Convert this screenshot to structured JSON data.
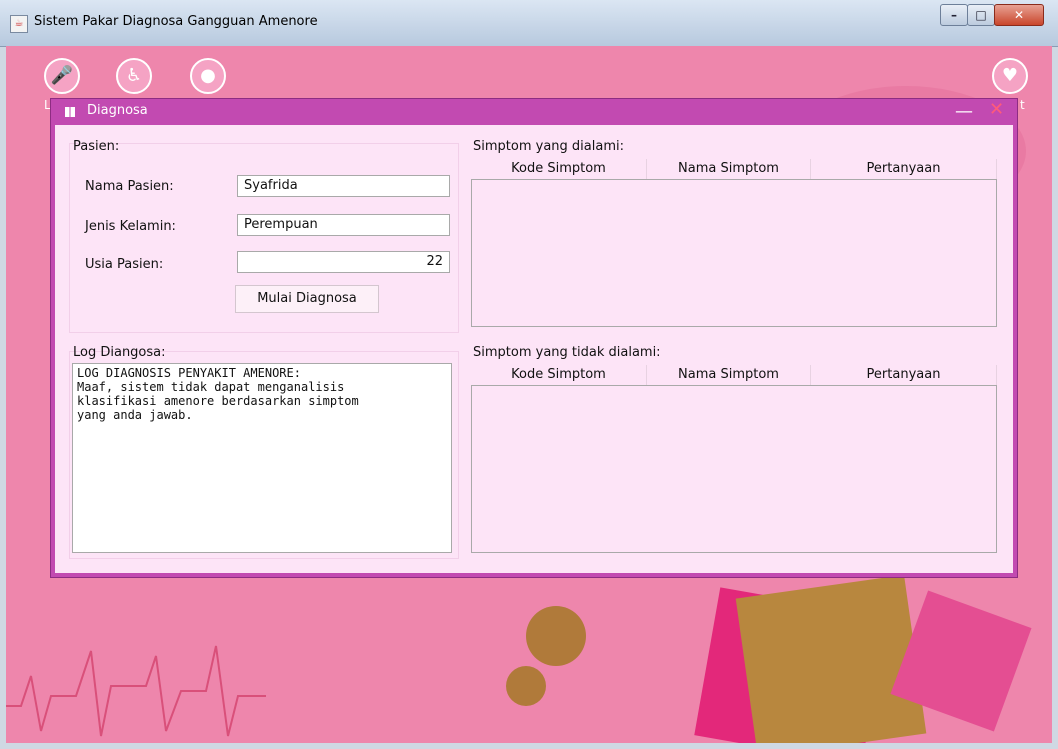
{
  "window": {
    "title": "Sistem Pakar Diagnosa Gangguan Amenore"
  },
  "toolbar": {
    "left_icons": [
      "microphone-icon",
      "wheelchair-icon",
      "user-icon"
    ],
    "right_icon": "heartbeat-icon",
    "peek_letter_left": "L",
    "peek_letter_right": "t"
  },
  "dialog": {
    "title": "Diagnosa",
    "minimize": "—",
    "close": "✕"
  },
  "patient": {
    "group_label": "Pasien:",
    "name_label": "Nama Pasien:",
    "name_value": "Syafrida",
    "gender_label": "Jenis Kelamin:",
    "gender_value": "Perempuan",
    "age_label": "Usia Pasien:",
    "age_value": "22",
    "start_button": "Mulai Diagnosa"
  },
  "log": {
    "group_label": "Log Diangosa:",
    "text": "LOG DIAGNOSIS PENYAKIT AMENORE:\nMaaf, sistem tidak dapat menganalisis\nklasifikasi amenore berdasarkan simptom\nyang anda jawab."
  },
  "symptoms_yes": {
    "group_label": "Simptom yang dialami:",
    "columns": [
      "Kode Simptom",
      "Nama Simptom",
      "Pertanyaan"
    ]
  },
  "symptoms_no": {
    "group_label": "Simptom yang tidak dialami:",
    "columns": [
      "Kode Simptom",
      "Nama Simptom",
      "Pertanyaan"
    ]
  }
}
